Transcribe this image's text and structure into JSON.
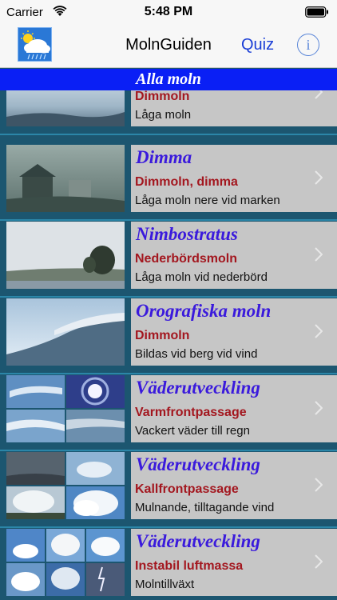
{
  "status": {
    "carrier": "Carrier",
    "time": "5:48 PM"
  },
  "nav": {
    "title": "MolnGuiden",
    "quiz_label": "Quiz",
    "info_label": "i"
  },
  "section": {
    "title": "Alla moln"
  },
  "rows": [
    {
      "title": "",
      "subtitle": "Dimmoln",
      "desc": "Låga moln"
    },
    {
      "title": "Dimma",
      "subtitle": "Dimmoln, dimma",
      "desc": "Låga moln nere vid marken"
    },
    {
      "title": "Nimbostratus",
      "subtitle": "Nederbördsmoln",
      "desc": "Låga moln vid nederbörd"
    },
    {
      "title": "Orografiska moln",
      "subtitle": "Dimmoln",
      "desc": "Bildas vid berg vid vind"
    },
    {
      "title": "Väderutveckling",
      "subtitle": "Varmfrontpassage",
      "desc": "Vackert väder till regn"
    },
    {
      "title": "Väderutveckling",
      "subtitle": "Kallfrontpassage",
      "desc": "Mulnande, tilltagande vind"
    },
    {
      "title": "Väderutveckling",
      "subtitle": "Instabil luftmassa",
      "desc": "Molntillväxt"
    }
  ],
  "colors": {
    "title": "#3a1adc",
    "subtitle": "#a3171f",
    "section_bg": "#0a1ff5",
    "list_bg": "#1c5670"
  }
}
